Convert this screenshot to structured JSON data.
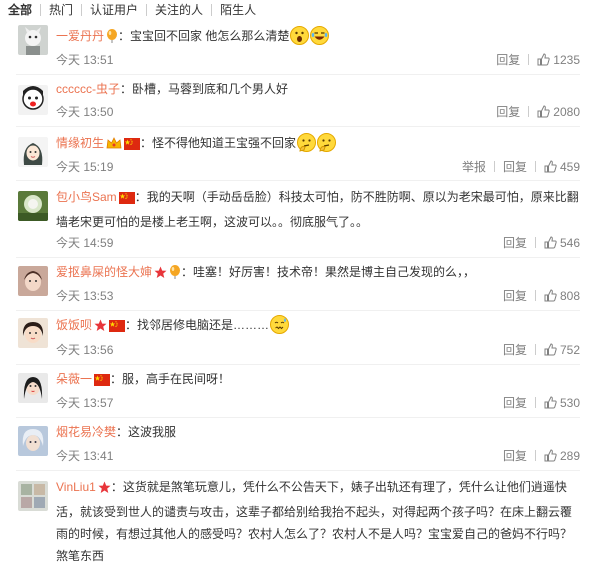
{
  "tabs": [
    "全部",
    "热门",
    "认证用户",
    "关注的人",
    "陌生人"
  ],
  "actions": {
    "reply": "回复",
    "report": "举报"
  },
  "colors": {
    "username": "#eb7350",
    "meta": "#808080",
    "link_blue": "#3b7fc7"
  },
  "comments": [
    {
      "user": "一爱丹丹",
      "badges": [
        "balloon-icon"
      ],
      "text": "：宝宝回不回家 他怎么那么清楚",
      "emojis": [
        "shocked-emoji",
        "laugh-tears-emoji"
      ],
      "time": "今天 13:51",
      "likes": "1235",
      "report": false
    },
    {
      "user": "cccccc-虫子",
      "badges": [],
      "text": "：卧槽，马蓉到底和几个男人好",
      "emojis": [],
      "time": "今天 13:50",
      "likes": "2080",
      "report": false
    },
    {
      "user": "情缘初生",
      "badges": [
        "vip-crown-icon",
        "china-flag-icon"
      ],
      "text": "：怪不得他知道王宝强不回家",
      "emojis": [
        "thinking-emoji",
        "thinking-emoji"
      ],
      "time": "今天 15:19",
      "likes": "459",
      "report": true
    },
    {
      "user": "包小鸟Sam",
      "badges": [
        "china-flag-icon"
      ],
      "text": "：我的天啊（手动岳岳脸）科技太可怕，防不胜防啊、原以为老宋最可怕，原来比翻墙老宋更可怕的是楼上老王啊，这波可以。。彻底服气了。。",
      "emojis": [],
      "time": "今天 14:59",
      "likes": "546",
      "report": false
    },
    {
      "user": "爱抠鼻屎的怪大婶",
      "badges": [
        "star-icon",
        "balloon-icon"
      ],
      "text": "：哇塞！好厉害！技术帝！果然是博主自己发现的么，，",
      "emojis": [],
      "time": "今天 13:53",
      "likes": "808",
      "report": false
    },
    {
      "user": "饭饭呗",
      "badges": [
        "star-icon",
        "china-flag-icon"
      ],
      "text": "：找邻居修电脑还是………",
      "emojis": [
        "sweat-emoji"
      ],
      "time": "今天 13:56",
      "likes": "752",
      "report": false
    },
    {
      "user": "朵薇一",
      "badges": [
        "china-flag-icon"
      ],
      "text": "：服，高手在民间呀！",
      "emojis": [],
      "time": "今天 13:57",
      "likes": "530",
      "report": false
    },
    {
      "user": "烟花易冷樊",
      "badges": [],
      "text": "：这波我服",
      "emojis": [],
      "time": "今天 13:41",
      "likes": "289",
      "report": false
    },
    {
      "user": "VinLiu1",
      "badges": [
        "star-icon"
      ],
      "text": "：这货就是煞笔玩意儿，凭什么不公告天下，婊子出轨还有理了，凭什么让他们逍遥快活，就该受到世人的谴责与攻击，这辈子都给别给我抬不起头，对得起两个孩子吗？在床上翻云覆雨的时候，有想过其他人的感受吗？农村人怎么了？农村人不是人吗？宝宝爱自己的爸妈不行吗？煞笔东西",
      "emojis": [],
      "time": "",
      "likes": "",
      "report": false
    }
  ]
}
